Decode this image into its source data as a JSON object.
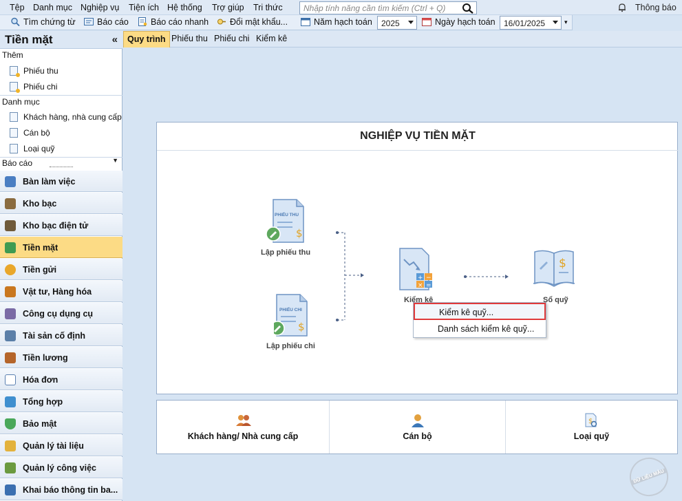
{
  "menu": [
    "Tệp",
    "Danh mục",
    "Nghiệp vụ",
    "Tiện ích",
    "Hệ thống",
    "Trợ giúp",
    "Tri thức"
  ],
  "search": {
    "placeholder": "Nhập tính năng cần tìm kiếm (Ctrl + Q)"
  },
  "notification": {
    "label": "Thông báo"
  },
  "toolbar": {
    "find_voucher": "Tìm chứng từ",
    "report": "Báo cáo",
    "quick_report": "Báo cáo nhanh",
    "change_password": "Đổi mật khẩu...",
    "fiscal_year_label": "Năm hạch toán",
    "fiscal_year_value": "2025",
    "posting_date_label": "Ngày hạch toán",
    "posting_date_value": "16/01/2025"
  },
  "left_panel": {
    "title": "Tiền mặt",
    "collapse": "«",
    "add_group": "Thêm",
    "add_items": [
      "Phiếu thu",
      "Phiếu chi"
    ],
    "catalog_group": "Danh mục",
    "catalog_items": [
      "Khách hàng, nhà cung cấp",
      "Cán bộ",
      "Loại quỹ"
    ],
    "report_group": "Báo cáo"
  },
  "nav": [
    "Bàn làm việc",
    "Kho bạc",
    "Kho bạc điện tử",
    "Tiền mặt",
    "Tiền gửi",
    "Vật tư, Hàng hóa",
    "Công cụ dụng cụ",
    "Tài sản cố định",
    "Tiền lương",
    "Hóa đơn",
    "Tổng hợp",
    "Bảo mật",
    "Quản lý tài liệu",
    "Quản lý công việc",
    "Khai báo thông tin ba..."
  ],
  "tabs": [
    "Quy trình",
    "Phiếu thu",
    "Phiếu chi",
    "Kiểm kê"
  ],
  "process": {
    "title": "NGHIỆP VỤ TIỀN MẶT",
    "receipt_doc_text": "PHIẾU THU",
    "payment_doc_text": "PHIẾU CHI",
    "receipt": "Lập phiếu thu",
    "payment": "Lập phiếu chi",
    "inventory": "Kiểm kê",
    "cashbook": "Sổ quỹ"
  },
  "context_menu": [
    "Kiểm kê quỹ...",
    "Danh sách kiểm kê quỹ..."
  ],
  "shortcuts": [
    "Khách hàng/ Nhà cung cấp",
    "Cán bộ",
    "Loại quỹ"
  ],
  "watermark": "DỮ LIỆU MẪU"
}
